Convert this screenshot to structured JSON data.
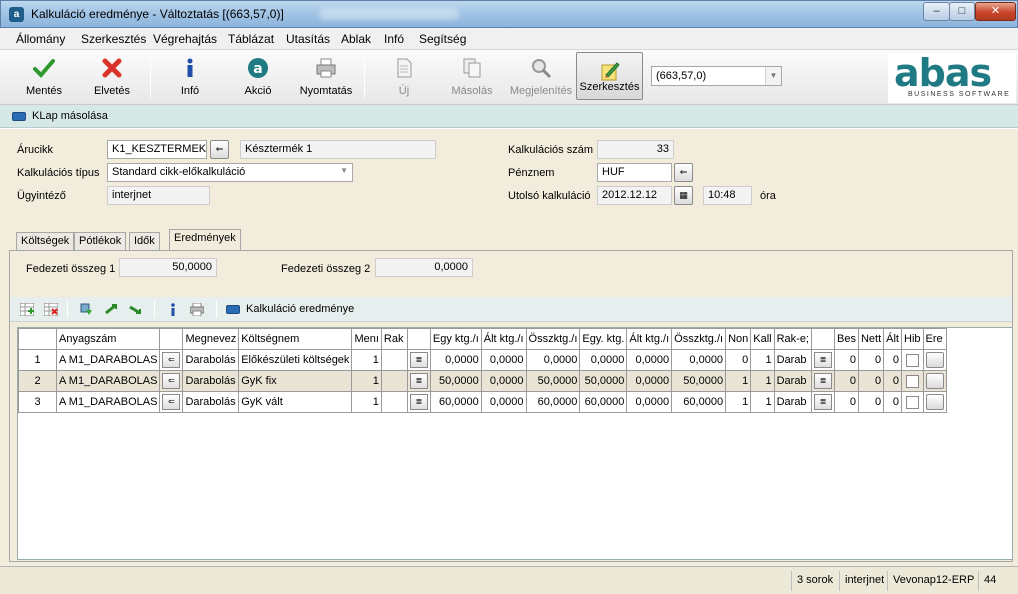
{
  "window": {
    "title": "Kalkuláció eredménye - Változtatás  [(663,57,0)]",
    "app_icon": "abas-icon",
    "buttons": {
      "minimize": "–",
      "maximize": "□",
      "close": "✕"
    }
  },
  "menu": [
    "Állomány",
    "Szerkesztés",
    "Végrehajtás",
    "Táblázat",
    "Utasítás",
    "Ablak",
    "Infó",
    "Segítség"
  ],
  "toolbar": {
    "mentes": "Mentés",
    "elvetes": "Elvetés",
    "info": "Infó",
    "akcio": "Akció",
    "nyomtatas": "Nyomtatás",
    "uj": "Új",
    "masolas": "Másolás",
    "megjelenites": "Megjelenítés",
    "szerkesztes": "Szerkesztés",
    "record_combo": "(663,57,0)"
  },
  "logo": {
    "brand": "abas",
    "tagline": "BUSINESS SOFTWARE"
  },
  "klap": {
    "label": "KLap másolása"
  },
  "form": {
    "arucikk_label": "Árucikk",
    "arucikk_value": "K1_KESZTERMEK",
    "arucikk_name": "Késztermék 1",
    "kalk_tipus_label": "Kalkulációs típus",
    "kalk_tipus_value": "Standard cikk-előkalkuláció",
    "ugyintezo_label": "Ügyintéző",
    "ugyintezo_value": "interjnet",
    "kalk_szam_label": "Kalkulációs szám",
    "kalk_szam_value": "33",
    "penznem_label": "Pénznem",
    "penznem_value": "HUF",
    "utolso_label": "Utolsó kalkuláció",
    "utolso_date": "2012.12.12",
    "utolso_time": "10:48",
    "ora": "óra"
  },
  "tabs": [
    "Költségek",
    "Pótlékok",
    "Idők",
    "Eredmények"
  ],
  "fedezet": {
    "label1": "Fedezeti összeg 1",
    "value1": "50,0000",
    "label2": "Fedezeti összeg 2",
    "value2": "0,0000"
  },
  "grid_toolbar": {
    "title": "Kalkuláció eredménye"
  },
  "table": {
    "headers": [
      "",
      "Anyagszám",
      "",
      "Megnevez",
      "Költségnem",
      "Menı",
      "Rak",
      "",
      "Egy ktg./ı",
      "Ált ktg./ı",
      "Összktg./ı",
      "Egy. ktg.",
      "Ált ktg./ı",
      "Összktg./ı",
      "Non",
      "Kall",
      "Rak-e;",
      "",
      "Bes",
      "Nett",
      "Ált",
      "Hib",
      "Ere"
    ],
    "rows": [
      {
        "num": "1",
        "anyag": "A M1_DARABOLAS",
        "megnev": "Darabolás",
        "koltseg": "Előkészületi költségek",
        "menny": "1",
        "rak": "",
        "egy1": "0,0000",
        "alt1": "0,0000",
        "ossz1": "0,0000",
        "egy2": "0,0000",
        "alt2": "0,0000",
        "ossz2": "0,0000",
        "non": "0",
        "kall": "1",
        "rake": "Darab",
        "bes": "0",
        "nett": "0",
        "alt": "0"
      },
      {
        "num": "2",
        "anyag": "A M1_DARABOLAS",
        "megnev": "Darabolás",
        "koltseg": "GyK fix",
        "menny": "1",
        "rak": "",
        "egy1": "50,0000",
        "alt1": "0,0000",
        "ossz1": "50,0000",
        "egy2": "50,0000",
        "alt2": "0,0000",
        "ossz2": "50,0000",
        "non": "1",
        "kall": "1",
        "rake": "Darab",
        "bes": "0",
        "nett": "0",
        "alt": "0"
      },
      {
        "num": "3",
        "anyag": "A M1_DARABOLAS",
        "megnev": "Darabolás",
        "koltseg": "GyK vált",
        "menny": "1",
        "rak": "",
        "egy1": "60,0000",
        "alt1": "0,0000",
        "ossz1": "60,0000",
        "egy2": "60,0000",
        "alt2": "0,0000",
        "ossz2": "60,0000",
        "non": "1",
        "kall": "1",
        "rake": "Darab",
        "bes": "0",
        "nett": "0",
        "alt": "0"
      }
    ]
  },
  "status": {
    "sorok": "3 sorok",
    "user": "interjnet",
    "system": "Vevonap12-ERP",
    "num": "44"
  }
}
